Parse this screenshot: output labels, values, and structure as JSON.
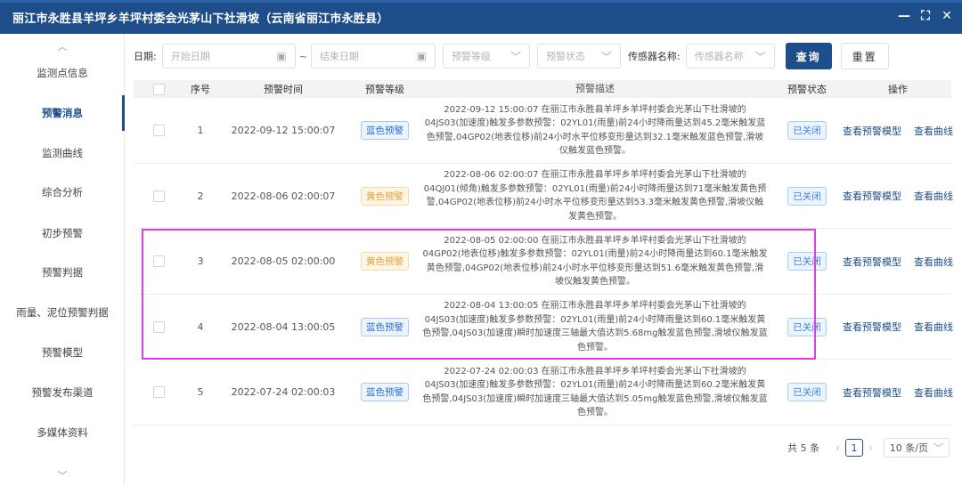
{
  "window": {
    "title": "丽江市永胜县羊坪乡羊坪村委会光茅山下社滑坡（云南省丽江市永胜县）",
    "controls": {
      "minimize": "—",
      "fullscreen": "⛶",
      "close": "✕"
    }
  },
  "sidebar": {
    "items": [
      {
        "label": "监测点信息"
      },
      {
        "label": "预警消息"
      },
      {
        "label": "监测曲线"
      },
      {
        "label": "综合分析"
      },
      {
        "label": "初步预警"
      },
      {
        "label": "预警判据"
      },
      {
        "label": "雨量、泥位预警判据"
      },
      {
        "label": "预警模型"
      },
      {
        "label": "预警发布渠道"
      },
      {
        "label": "多媒体资料"
      }
    ],
    "active": "预警消息"
  },
  "filter": {
    "date_label": "日期:",
    "start_placeholder": "开始日期",
    "end_placeholder": "结束日期",
    "tilde": "~",
    "level_placeholder": "预警等级",
    "status_placeholder": "预警状态",
    "sensor_label": "传感器名称:",
    "sensor_placeholder": "传感器名称",
    "query_button": "查询",
    "reset_button": "重置"
  },
  "table": {
    "headers": [
      "序号",
      "预警时间",
      "预警等级",
      "预警描述",
      "预警状态",
      "操作"
    ],
    "rows": [
      {
        "no": "1",
        "time": "2022-09-12 15:00:07",
        "level": "蓝色预警",
        "level_color": "blue",
        "desc": "2022-09-12 15:00:07 在丽江市永胜县羊坪乡羊坪村委会光茅山下社滑坡的04JS03(加速度)触发多参数预警：02YL01(雨量)前24小时降雨量达到45.2毫米触发蓝色预警,04GP02(地表位移)前24小时水平位移变形量达到32.1毫米触发蓝色预警,滑坡仪触发蓝色预警。",
        "status": "已关闭",
        "op1": "查看预警模型",
        "op2": "查看曲线"
      },
      {
        "no": "2",
        "time": "2022-08-06 02:00:07",
        "level": "黄色预警",
        "level_color": "yellow",
        "desc": "2022-08-06 02:00:07 在丽江市永胜县羊坪乡羊坪村委会光茅山下社滑坡的04QJ01(倾角)触发多参数预警：02YL01(雨量)前24小时降雨量达到71毫米触发黄色预警,04GP02(地表位移)前24小时水平位移变形量达到53.3毫米触发黄色预警,滑坡仪触发黄色预警。",
        "status": "已关闭",
        "op1": "查看预警模型",
        "op2": "查看曲线"
      },
      {
        "no": "3",
        "time": "2022-08-05 02:00:00",
        "level": "黄色预警",
        "level_color": "yellow",
        "desc": "2022-08-05 02:00:00 在丽江市永胜县羊坪乡羊坪村委会光茅山下社滑坡的04GP02(地表位移)触发多参数预警：02YL01(雨量)前24小时降雨量达到60.1毫米触发黄色预警,04GP02(地表位移)前24小时水平位移变形量达到51.6毫米触发黄色预警,滑坡仪触发黄色预警。",
        "status": "已关闭",
        "op1": "查看预警模型",
        "op2": "查看曲线"
      },
      {
        "no": "4",
        "time": "2022-08-04 13:00:05",
        "level": "蓝色预警",
        "level_color": "blue",
        "desc": "2022-08-04 13:00:05 在丽江市永胜县羊坪乡羊坪村委会光茅山下社滑坡的04JS03(加速度)触发多参数预警：02YL01(雨量)前24小时降雨量达到60.1毫米触发黄色预警,04JS03(加速度)瞬时加速度三轴最大值达到5.68mg触发蓝色预警,滑坡仪触发蓝色预警。",
        "status": "已关闭",
        "op1": "查看预警模型",
        "op2": "查看曲线"
      },
      {
        "no": "5",
        "time": "2022-07-24 02:00:03",
        "level": "蓝色预警",
        "level_color": "blue",
        "desc": "2022-07-24 02:00:03 在丽江市永胜县羊坪乡羊坪村委会光茅山下社滑坡的04JS03(加速度)触发多参数预警：02YL01(雨量)前24小时降雨量达到60.2毫米触发黄色预警,04JS03(加速度)瞬时加速度三轴最大值达到5.05mg触发蓝色预警,滑坡仪触发蓝色预警。",
        "status": "已关闭",
        "op1": "查看预警模型",
        "op2": "查看曲线"
      }
    ]
  },
  "pagination": {
    "total": "共 5 条",
    "current_page": "1",
    "page_size": "10 条/页"
  },
  "colors": {
    "primary": "#1d4e89",
    "highlight": "#e23ce5",
    "blue_tag": "#2f6fd6",
    "yellow_tag": "#e6a23c"
  }
}
